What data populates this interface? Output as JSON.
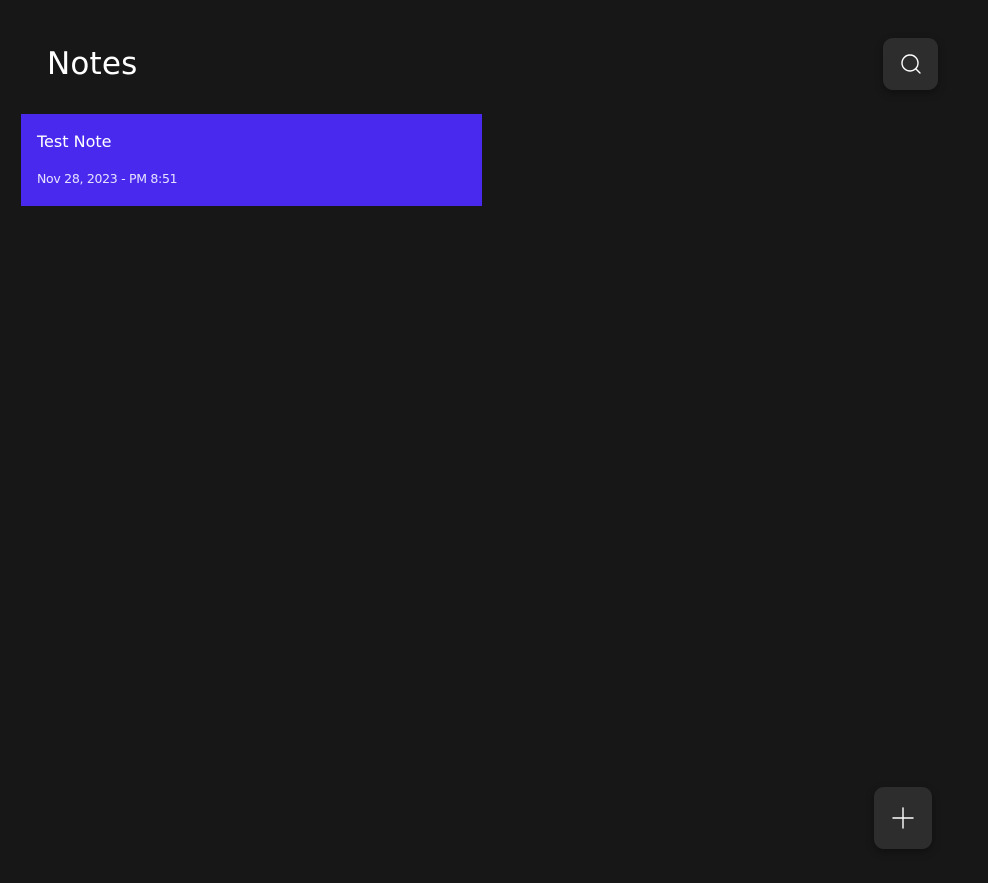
{
  "header": {
    "title": "Notes",
    "search_icon": "search-icon"
  },
  "notes": [
    {
      "title": "Test Note",
      "date": "Nov 28, 2023 - PM 8:51",
      "color": "#4a29ef"
    }
  ],
  "fab": {
    "icon": "plus-icon"
  },
  "colors": {
    "background": "#171717",
    "button_bg": "#2d2d2d",
    "accent": "#4a29ef",
    "text": "#ffffff"
  }
}
